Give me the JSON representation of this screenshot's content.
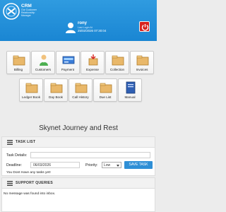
{
  "app": {
    "brand": "CRM",
    "brand_sub": "Our Customer Relationship Manager"
  },
  "user": {
    "name": "rony",
    "last_login_label": "Last Login At",
    "last_login": "25/02/2026 07:30:04"
  },
  "nav_tiles": [
    {
      "label": "Billing",
      "icon": "billing-icon"
    },
    {
      "label": "Customers",
      "icon": "customers-icon"
    },
    {
      "label": "Payment",
      "icon": "payment-icon"
    },
    {
      "label": "Expense",
      "icon": "expense-icon"
    },
    {
      "label": "Collection",
      "icon": "collection-icon"
    },
    {
      "label": "Invoices",
      "icon": "invoices-icon"
    },
    {
      "label": "Ledger Book",
      "icon": "ledger-book-icon"
    },
    {
      "label": "Day Book",
      "icon": "day-book-icon"
    },
    {
      "label": "Call History",
      "icon": "call-history-icon"
    },
    {
      "label": "Due List",
      "icon": "due-list-icon"
    },
    {
      "label": "Manual",
      "icon": "manual-icon"
    }
  ],
  "page_title": "Skynet Journey and Rest",
  "task_panel": {
    "title": "TASK LIST",
    "details_label": "Task Details:",
    "details_value": "",
    "deadline_label": "Deadline:",
    "deadline_value": "06/03/2026",
    "priority_label": "Priority:",
    "priority_value": "Low",
    "save_label": "SAVE TASK",
    "empty_note": "You Dont Have any tasks yet!"
  },
  "support_panel": {
    "title": "SUPPORT QUERIES",
    "empty_note": "No message was found into inbox."
  },
  "colors": {
    "header": "#1a86d3",
    "power": "#d8231e",
    "save_button": "#2f8fd6"
  }
}
